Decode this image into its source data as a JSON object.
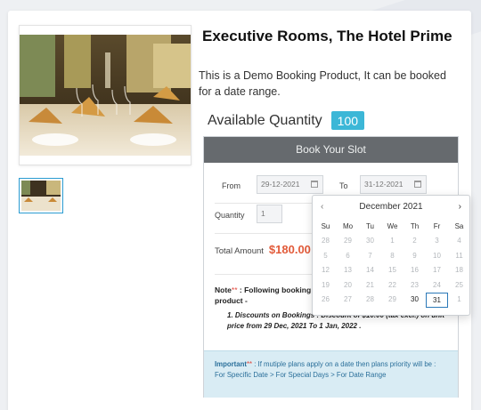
{
  "product": {
    "title": "Executive Rooms, The Hotel Prime",
    "description": "This is a Demo Booking Product, It can be booked for a date range.",
    "available_label": "Available Quantity",
    "available_qty": "100"
  },
  "booking": {
    "header": "Book Your Slot",
    "from_label": "From",
    "from_value": "29-12-2021",
    "to_label": "To",
    "to_value": "31-12-2021",
    "quantity_label": "Quantity",
    "quantity_value": "1",
    "total_label": "Total Amount",
    "total_value": "$180.00",
    "note_label": "Note",
    "note_star": "**",
    "note_text": " : Following booking",
    "note_text2": "product -",
    "discount_text": "1. Discounts on Bookings : Discount of $10.00 (tax excl.) on unit price from 29 Dec, 2021 To 1 Jan, 2022 .",
    "important_label": "Important",
    "important_star": "**",
    "important_text": " : If mutiple plans apply on a date then plans priority will be :",
    "important_priority": "For Specific Date > For Special Days > For Date Range"
  },
  "calendar": {
    "prev": "‹",
    "next": "›",
    "month": "December 2021",
    "weekdays": [
      "Su",
      "Mo",
      "Tu",
      "We",
      "Th",
      "Fr",
      "Sa"
    ],
    "days": [
      [
        "28",
        "29",
        "30",
        "1",
        "2",
        "3",
        "4"
      ],
      [
        "5",
        "6",
        "7",
        "8",
        "9",
        "10",
        "11"
      ],
      [
        "12",
        "13",
        "14",
        "15",
        "16",
        "17",
        "18"
      ],
      [
        "19",
        "20",
        "21",
        "22",
        "23",
        "24",
        "25"
      ],
      [
        "26",
        "27",
        "28",
        "29",
        "30",
        "31",
        "1"
      ]
    ],
    "active_days": [
      "30",
      "31"
    ],
    "selected_day": "31"
  }
}
